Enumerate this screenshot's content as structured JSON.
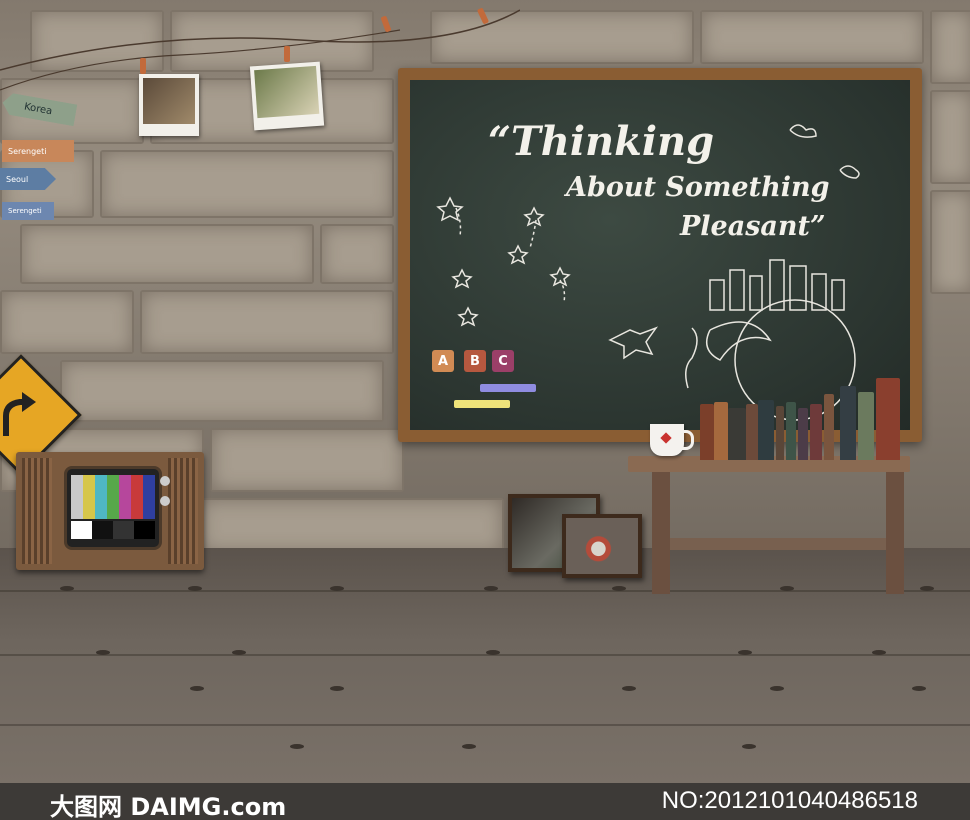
{
  "chalkboard": {
    "line1": "“Thinking",
    "line2": "About Something",
    "line3": "Pleasant”",
    "blocks": [
      "A",
      "B",
      "C"
    ]
  },
  "signs": [
    "Korea",
    "Serengeti",
    "Seoul",
    "Serengeti"
  ],
  "watermark": {
    "site": "大图网 DAIMG.com",
    "number": "NO:20121010404865​18"
  },
  "colors": {
    "board": "#2b3530",
    "frame": "#8a5d33",
    "wall": "#9b9184",
    "floor": "#6e665e"
  },
  "tv_bars": [
    "#c9c9c9",
    "#d6c64a",
    "#4fb7c4",
    "#57a84a",
    "#b6479c",
    "#c83a3a",
    "#2f3fa0"
  ]
}
